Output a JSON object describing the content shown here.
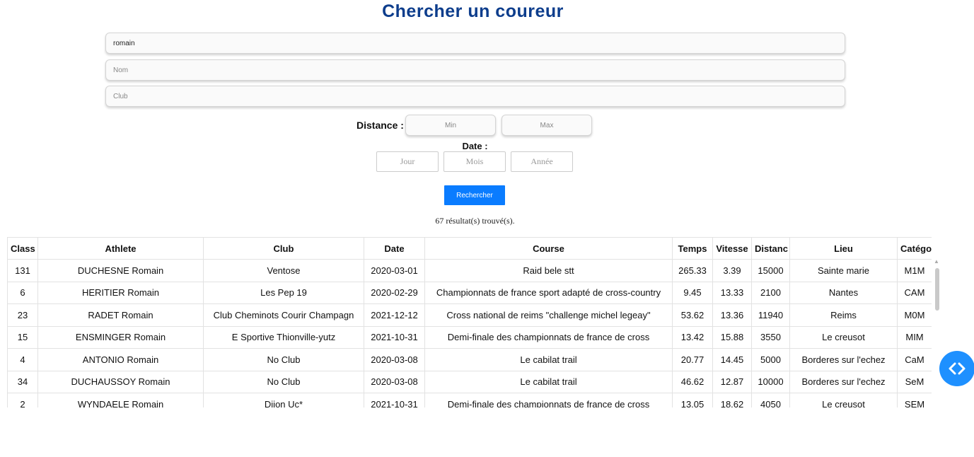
{
  "page": {
    "title": "Chercher un coureur"
  },
  "search": {
    "prenom_value": "romain",
    "nom_placeholder": "Nom",
    "club_placeholder": "Club",
    "distance_label": "Distance :",
    "min_placeholder": "Min",
    "max_placeholder": "Max",
    "date_label": "Date :",
    "jour_placeholder": "Jour",
    "mois_placeholder": "Mois",
    "annee_placeholder": "Année",
    "submit_label": "Rechercher"
  },
  "results": {
    "count_text": "67 résultat(s) trouvé(s)."
  },
  "table": {
    "headers": [
      "Class",
      "Athlete",
      "Club",
      "Date",
      "Course",
      "Temps",
      "Vitesse",
      "Distanc",
      "Lieu",
      "Catégo"
    ],
    "rows": [
      [
        "131",
        "DUCHESNE Romain",
        "Ventose",
        "2020-03-01",
        "Raid bele stt",
        "265.33",
        "3.39",
        "15000",
        "Sainte marie",
        "M1M"
      ],
      [
        "6",
        "HERITIER Romain",
        "Les Pep 19",
        "2020-02-29",
        "Championnats de france sport adapté de cross-country",
        "9.45",
        "13.33",
        "2100",
        "Nantes",
        "CAM"
      ],
      [
        "23",
        "RADET Romain",
        "Club Cheminots Courir Champagn",
        "2021-12-12",
        "Cross national de reims \"challenge michel legeay\"",
        "53.62",
        "13.36",
        "11940",
        "Reims",
        "M0M"
      ],
      [
        "15",
        "ENSMINGER Romain",
        "E Sportive Thionville-yutz",
        "2021-10-31",
        "Demi-finale des championnats de france de cross",
        "13.42",
        "15.88",
        "3550",
        "Le creusot",
        "MIM"
      ],
      [
        "4",
        "ANTONIO Romain",
        "No Club",
        "2020-03-08",
        "Le cabilat trail",
        "20.77",
        "14.45",
        "5000",
        "Borderes sur l'echez",
        "CaM"
      ],
      [
        "34",
        "DUCHAUSSOY Romain",
        "No Club",
        "2020-03-08",
        "Le cabilat trail",
        "46.62",
        "12.87",
        "10000",
        "Borderes sur l'echez",
        "SeM"
      ],
      [
        "2",
        "WYNDAELE Romain",
        "Dijon Uc*",
        "2021-10-31",
        "Demi-finale des championnats de france de cross",
        "13.05",
        "18.62",
        "4050",
        "Le creusot",
        "SEM"
      ]
    ]
  },
  "icons": {
    "floating_button": "code-icon",
    "scroll_up": "triangle-up-icon"
  },
  "colors": {
    "title": "#0d3d8c",
    "button": "#0a7cff",
    "floating_button": "#1e90ff"
  }
}
